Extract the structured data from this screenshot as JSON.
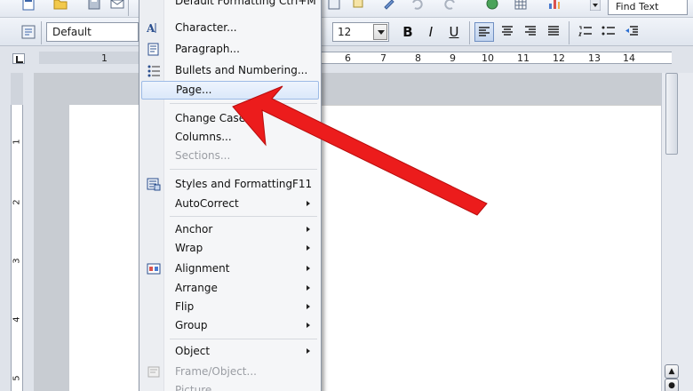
{
  "toolbar": {
    "paragraph_style": "Default",
    "font_size": "12",
    "bold_label": "B",
    "italic_label": "I",
    "underline_label": "U",
    "find_text": "Find Text",
    "icons": [
      "new-document-icon",
      "open-folder-icon",
      "save-icon",
      "email-icon",
      "export-pdf-icon",
      "styles-icon",
      "align-left-icon",
      "align-center-icon",
      "align-right-icon",
      "justify-icon",
      "numbering-icon",
      "bullets-icon",
      "decrease-indent-icon"
    ]
  },
  "ruler": {
    "h_labels": [
      "1",
      "6",
      "7",
      "8",
      "9",
      "10",
      "11",
      "12",
      "13",
      "14"
    ],
    "v_labels": [
      "1",
      "2",
      "3",
      "4",
      "5"
    ]
  },
  "menu": {
    "top_item": "Default Formatting Ctrl+M",
    "items": [
      {
        "label": "Character...",
        "icon": "character-icon"
      },
      {
        "label": "Paragraph...",
        "icon": "paragraph-icon"
      },
      {
        "label": "Bullets and Numbering...",
        "icon": "bullets-numbering-icon"
      },
      {
        "label": "Page..."
      },
      {
        "label": "Change Case"
      },
      {
        "label": "Columns..."
      },
      {
        "label": "Sections..."
      },
      {
        "label": "Styles and Formatting",
        "shortcut": "F11",
        "icon": "styles-formatting-icon"
      },
      {
        "label": "AutoCorrect"
      },
      {
        "label": "Anchor"
      },
      {
        "label": "Wrap"
      },
      {
        "label": "Alignment",
        "icon": "alignment-icon"
      },
      {
        "label": "Arrange"
      },
      {
        "label": "Flip"
      },
      {
        "label": "Group"
      },
      {
        "label": "Object"
      },
      {
        "label": "Frame/Object...",
        "icon": "frame-object-icon"
      },
      {
        "label": "Picture..."
      }
    ]
  },
  "colors": {
    "arrow": "#ec1c1c",
    "highlight": "#dbe8fa"
  }
}
